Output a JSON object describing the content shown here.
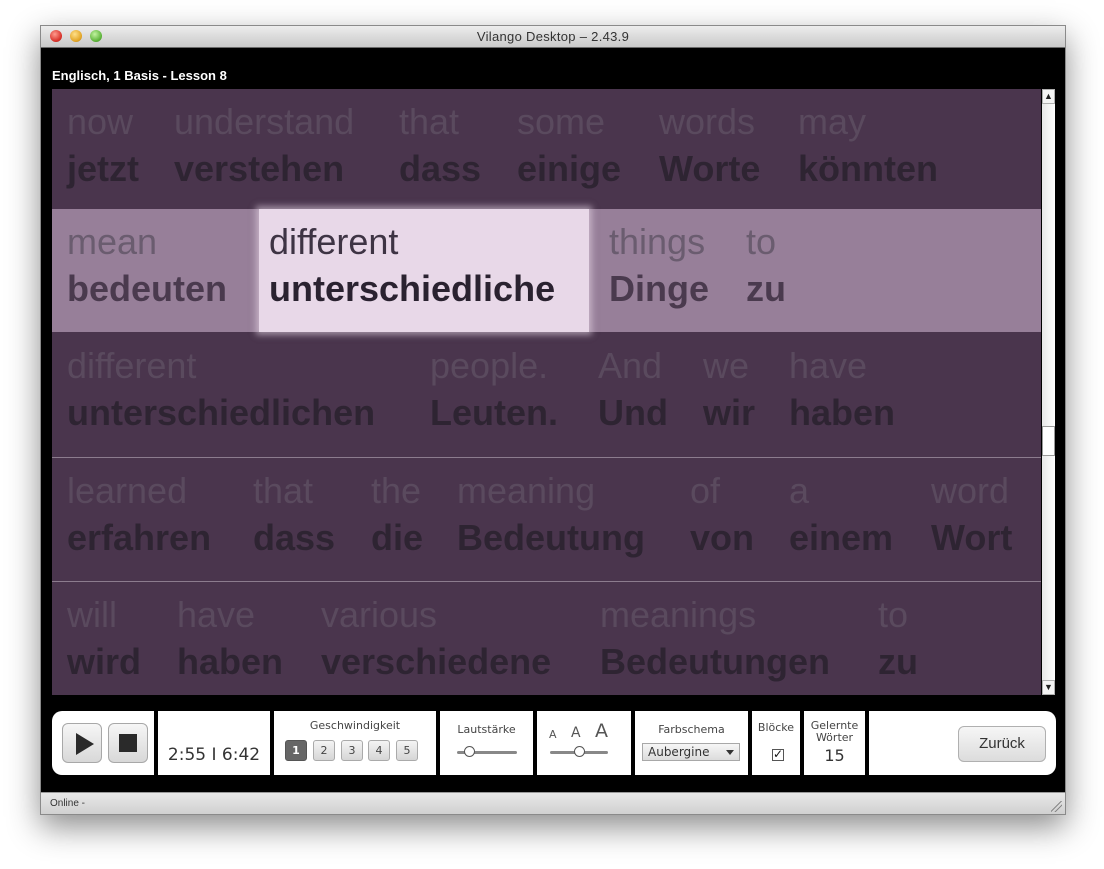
{
  "window": {
    "title": "Vilango Desktop – 2.43.9"
  },
  "lesson": {
    "title": "Englisch, 1 Basis - Lesson 8"
  },
  "rows": [
    {
      "words": [
        {
          "en": "now",
          "de": "jetzt"
        },
        {
          "en": "understand",
          "de": "verstehen"
        },
        {
          "en": "that",
          "de": "dass"
        },
        {
          "en": "some",
          "de": "einige"
        },
        {
          "en": "words",
          "de": "Worte"
        },
        {
          "en": "may",
          "de": "könnten"
        }
      ]
    },
    {
      "words": [
        {
          "en": "mean",
          "de": "bedeuten"
        },
        {
          "en": "different",
          "de": "unterschiedliche"
        },
        {
          "en": "things",
          "de": "Dinge"
        },
        {
          "en": "to",
          "de": "zu"
        }
      ]
    },
    {
      "words": [
        {
          "en": "different",
          "de": "unterschiedlichen"
        },
        {
          "en": "people.",
          "de": "Leuten."
        },
        {
          "en": "And",
          "de": "Und"
        },
        {
          "en": "we",
          "de": "wir"
        },
        {
          "en": "have",
          "de": "haben"
        }
      ]
    },
    {
      "words": [
        {
          "en": "learned",
          "de": "erfahren"
        },
        {
          "en": "that",
          "de": "dass"
        },
        {
          "en": "the",
          "de": "die"
        },
        {
          "en": "meaning",
          "de": "Bedeutung"
        },
        {
          "en": "of",
          "de": "von"
        },
        {
          "en": "a",
          "de": "einem"
        },
        {
          "en": "word",
          "de": "Wort"
        }
      ]
    },
    {
      "words": [
        {
          "en": "will",
          "de": "wird"
        },
        {
          "en": "have",
          "de": "haben"
        },
        {
          "en": "various",
          "de": "verschiedene"
        },
        {
          "en": "meanings",
          "de": "Bedeutungen"
        },
        {
          "en": "to",
          "de": "zu"
        }
      ]
    }
  ],
  "playback": {
    "play_icon": "play-icon",
    "stop_icon": "stop-icon",
    "time": "2:55 I 6:42"
  },
  "speed": {
    "label": "Geschwindigkeit",
    "options": [
      "1",
      "2",
      "3",
      "4",
      "5"
    ],
    "selected": "1"
  },
  "volume": {
    "label": "Lautstärke",
    "level": 0.2
  },
  "font_size": {
    "small": "A",
    "medium": "A",
    "large": "A",
    "level": 0.5
  },
  "color_scheme": {
    "label": "Farbschema",
    "value": "Aubergine"
  },
  "blocks": {
    "label": "Blöcke",
    "checked": true
  },
  "learned_words": {
    "label_line1": "Gelernte",
    "label_line2": "Wörter",
    "count": "15"
  },
  "back_button": {
    "label": "Zurück"
  },
  "status": {
    "text": "Online -"
  },
  "colors": {
    "background": "#4a354d",
    "active_row": "#977f99",
    "current_word": "#e8d8e8"
  }
}
